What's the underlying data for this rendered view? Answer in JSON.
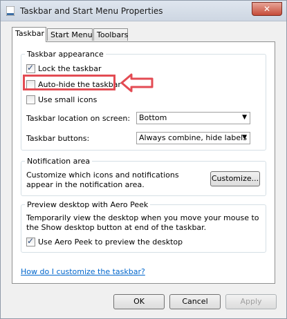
{
  "window": {
    "title": "Taskbar and Start Menu Properties",
    "close_label": "✕"
  },
  "tabs": [
    {
      "label": "Taskbar",
      "active": true
    },
    {
      "label": "Start Menu",
      "active": false
    },
    {
      "label": "Toolbars",
      "active": false
    }
  ],
  "appearance": {
    "legend": "Taskbar appearance",
    "lock_label": "Lock the taskbar",
    "lock_checked": true,
    "autohide_label": "Auto-hide the taskbar",
    "autohide_checked": false,
    "small_icons_label": "Use small icons",
    "small_icons_checked": false,
    "location_label": "Taskbar location on screen:",
    "location_value": "Bottom",
    "buttons_label": "Taskbar buttons:",
    "buttons_value": "Always combine, hide labels"
  },
  "notification": {
    "legend": "Notification area",
    "description": "Customize which icons and notifications appear in the notification area.",
    "customize_label": "Customize..."
  },
  "aero": {
    "legend": "Preview desktop with Aero Peek",
    "description": "Temporarily view the desktop when you move your mouse to the Show desktop button at end of the taskbar.",
    "checkbox_label": "Use Aero Peek to preview the desktop",
    "checked": true
  },
  "help_link": "How do I customize the taskbar?",
  "footer": {
    "ok_label": "OK",
    "cancel_label": "Cancel",
    "apply_label": "Apply"
  },
  "annotation": {
    "highlight_color": "#e34b53"
  }
}
